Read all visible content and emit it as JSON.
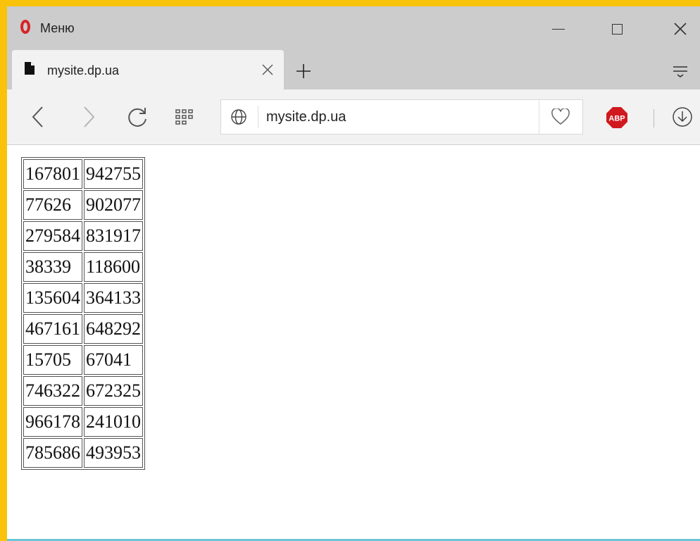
{
  "window": {
    "title": "Меню"
  },
  "tab": {
    "title": "mysite.dp.ua"
  },
  "address_bar": {
    "url": "mysite.dp.ua"
  },
  "extensions": {
    "adblock_label": "ABP"
  },
  "colors": {
    "frame": "#f9c20b",
    "chrome": "#cccccc",
    "toolbar": "#f2f2f2",
    "opera_red": "#d8232a",
    "abp_red": "#d0191f"
  },
  "icons": [
    "opera-logo-icon",
    "minimize-icon",
    "maximize-icon",
    "close-icon",
    "file-icon",
    "tab-close-icon",
    "plus-icon",
    "tab-menu-icon",
    "back-icon",
    "forward-icon",
    "reload-icon",
    "speed-dial-icon",
    "globe-icon",
    "heart-icon",
    "adblock-icon",
    "download-icon"
  ],
  "table": {
    "rows": [
      [
        "167801",
        "942755"
      ],
      [
        "77626",
        "902077"
      ],
      [
        "279584",
        "831917"
      ],
      [
        "38339",
        "118600"
      ],
      [
        "135604",
        "364133"
      ],
      [
        "467161",
        "648292"
      ],
      [
        "15705",
        "67041"
      ],
      [
        "746322",
        "672325"
      ],
      [
        "966178",
        "241010"
      ],
      [
        "785686",
        "493953"
      ]
    ]
  }
}
